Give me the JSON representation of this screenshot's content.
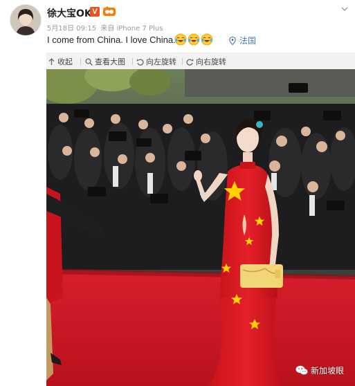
{
  "post": {
    "username": "徐大宝OK",
    "vip_badge": "V",
    "date": "5月18日 09:15",
    "source_prefix": "来自",
    "source": "iPhone 7 Plus",
    "text": "I come from China. I love China.",
    "emoji_icons": [
      "laughing-tears-emoji",
      "laughing-tears-emoji",
      "laughing-tears-emoji"
    ],
    "location": "法国"
  },
  "toolbar": {
    "collapse_label": "收起",
    "view_large_label": "查看大图",
    "rotate_left_label": "向左旋转",
    "rotate_right_label": "向右旋转"
  },
  "photo": {
    "watermark": "新加坡眼"
  },
  "colors": {
    "link": "#4a7ab0",
    "vip_badge": "#e8541b",
    "dress_red": "#d7191c",
    "carpet_red": "#e0202c",
    "star_yellow": "#ffd400"
  }
}
